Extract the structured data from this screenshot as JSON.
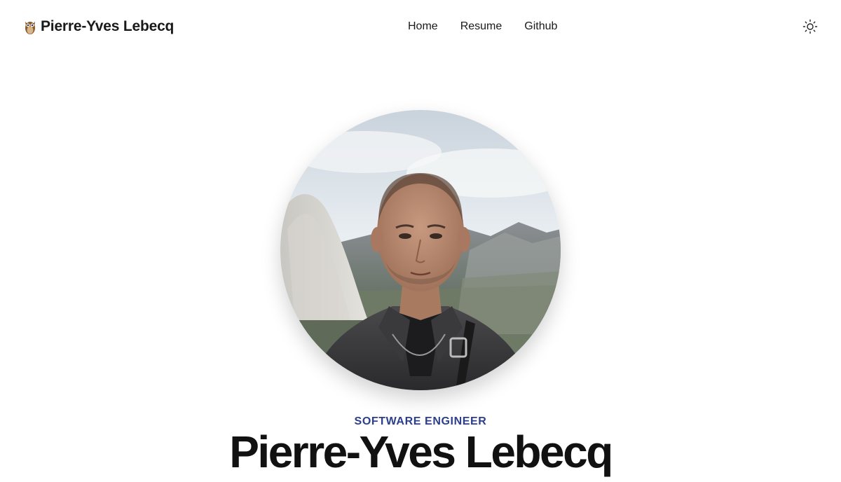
{
  "header": {
    "brand_name": "Pierre-Yves Lebecq",
    "brand_icon": "owl-emoji-icon",
    "nav": [
      {
        "label": "Home"
      },
      {
        "label": "Resume"
      },
      {
        "label": "Github"
      }
    ],
    "theme_toggle_icon": "sun-icon"
  },
  "hero": {
    "role": "SOFTWARE ENGINEER",
    "name": "Pierre-Yves Lebecq"
  },
  "colors": {
    "accent": "#2b3f8c",
    "text": "#111111",
    "background": "#ffffff"
  }
}
